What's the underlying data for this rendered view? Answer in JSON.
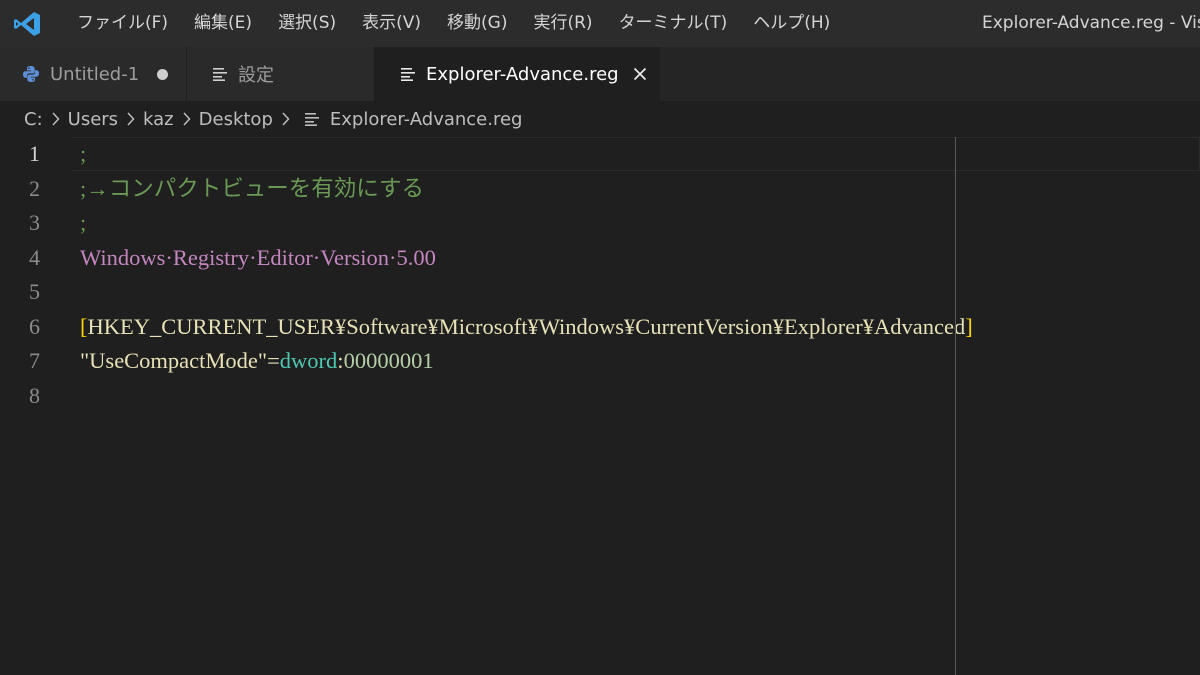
{
  "titlebar": {
    "menu": [
      "ファイル(F)",
      "編集(E)",
      "選択(S)",
      "表示(V)",
      "移動(G)",
      "実行(R)",
      "ターミナル(T)",
      "ヘルプ(H)"
    ],
    "window_title": "Explorer-Advance.reg - Vis"
  },
  "tabs": [
    {
      "label": "Untitled-1",
      "icon": "python-icon",
      "modified": true
    },
    {
      "label": "設定",
      "icon": "settings-file-icon",
      "modified": false
    },
    {
      "label": "Explorer-Advance.reg",
      "icon": "file-lines-icon",
      "active": true
    }
  ],
  "breadcrumb": [
    "C:",
    "Users",
    "kaz",
    "Desktop",
    "Explorer-Advance.reg"
  ],
  "editor": {
    "line_numbers": [
      "1",
      "2",
      "3",
      "4",
      "5",
      "6",
      "7",
      "8"
    ],
    "current_line": 1,
    "lines": {
      "l1": ";",
      "l2": ";→コンパクトビューを有効にする",
      "l3": ";",
      "l4": "Windows·Registry·Editor·Version·5.00",
      "l5": "",
      "l6_open": "[",
      "l6_key": "HKEY_CURRENT_USER¥Software¥Microsoft¥Windows¥CurrentVersion¥Explorer¥Advanced",
      "l6_close": "]",
      "l7_name": "\"UseCompactMode\"",
      "l7_eq": "=",
      "l7_type": "dword",
      "l7_colon": ":",
      "l7_value": "00000001",
      "l8": ""
    }
  },
  "colors": {
    "accent_logo": "#3ba0e6",
    "comment": "#6a9955",
    "header": "#c586c0",
    "bracket": "#ffd700",
    "type": "#4ec9b0"
  }
}
